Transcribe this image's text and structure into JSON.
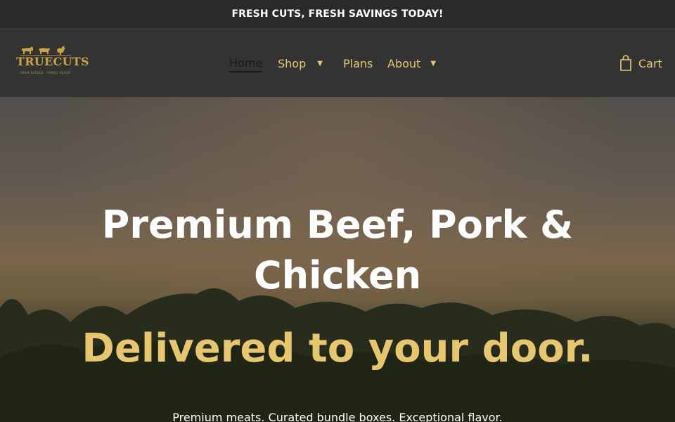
{
  "announcement": "FRESH CUTS, FRESH SAVINGS TODAY!",
  "logo": {
    "name": "TRUECUTS",
    "tagline": "FARM RAISED · FAMILY READY"
  },
  "nav": {
    "home": "Home",
    "shop": "Shop",
    "plans": "Plans",
    "about": "About",
    "caret": "▼"
  },
  "cart": {
    "label": "Cart"
  },
  "hero": {
    "title": "Premium Beef, Pork & Chicken",
    "subtitle": "Delivered to your door.",
    "tagline": "Premium meats. Curated bundle boxes. Exceptional flavor."
  },
  "colors": {
    "accent": "#e8c77a",
    "headline_gold": "#e6c66e",
    "header_bg": "#333333",
    "announcement_bg": "#2a2a2a"
  }
}
